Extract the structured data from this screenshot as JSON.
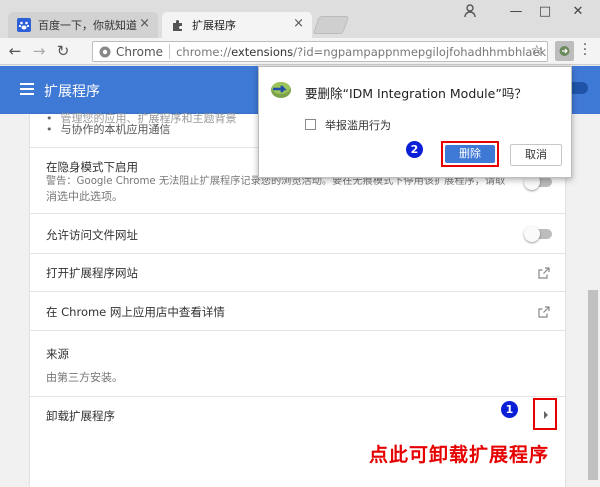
{
  "tabs": [
    {
      "label": "百度一下，你就知道",
      "icon": "baidu-paw-icon",
      "active": false
    },
    {
      "label": "扩展程序",
      "icon": "puzzle-icon",
      "active": true
    }
  ],
  "toolbar": {
    "chrome_label": "Chrome",
    "url_scheme": "chrome://",
    "url_host": "extensions",
    "url_rest": "/?id=ngpampappnmepgilojfohadhhmbhlaek"
  },
  "appbar": {
    "title": "扩展程序"
  },
  "details": {
    "bullets": [
      "管理您的应用、扩展程序和主题背景",
      "与协作的本机应用通信"
    ],
    "incognito": {
      "title": "在隐身模式下启用",
      "warning_line1": "警告：Google Chrome 无法阻止扩展程序记录您的浏览活动。要在无痕模式下停用该扩展程序，请取",
      "warning_line2": "消选中此选项。"
    },
    "file_urls": {
      "title": "允许访问文件网址"
    },
    "open_site": {
      "title": "打开扩展程序网站"
    },
    "webstore": {
      "title": "在 Chrome 网上应用店中查看详情"
    },
    "source": {
      "title": "来源",
      "value": "由第三方安装。"
    },
    "uninstall": {
      "title": "卸载扩展程序"
    }
  },
  "dialog": {
    "title": "要删除“IDM Integration Module”吗？",
    "checkbox_label": "举报滥用行为",
    "delete_label": "删除",
    "cancel_label": "取消"
  },
  "annotations": {
    "step1": "1",
    "step2": "2",
    "callout": "点此可卸载扩展程序"
  },
  "colors": {
    "accent": "#3f79d6",
    "annotation_red": "#e60000",
    "badge_blue": "#0b1fd6"
  }
}
